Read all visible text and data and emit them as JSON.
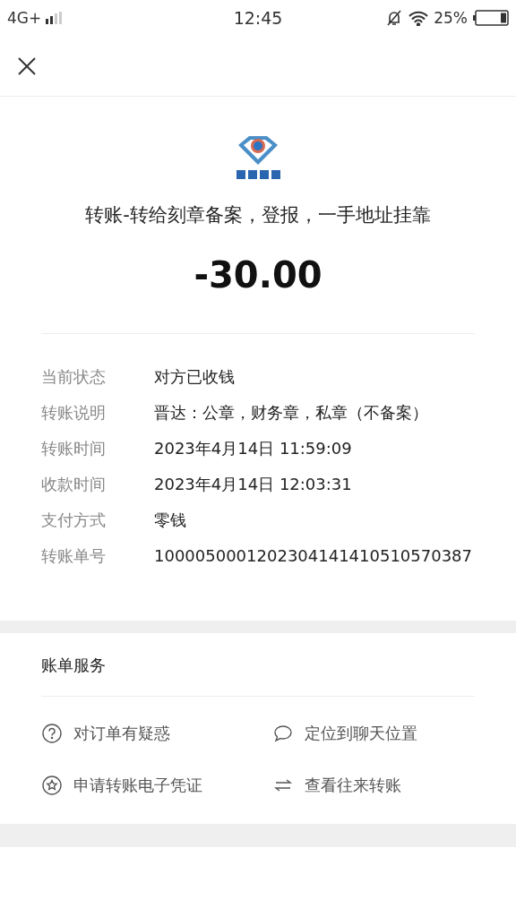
{
  "status_bar": {
    "network": "4G+",
    "time": "12:45",
    "battery": "25%"
  },
  "title": "转账-转给刻章备案，登报，一手地址挂靠",
  "amount": "-30.00",
  "details": [
    {
      "label": "当前状态",
      "value": "对方已收钱"
    },
    {
      "label": "转账说明",
      "value": "晋达：公章，财务章，私章（不备案）"
    },
    {
      "label": "转账时间",
      "value": "2023年4月14日 11:59:09"
    },
    {
      "label": "收款时间",
      "value": "2023年4月14日 12:03:31"
    },
    {
      "label": "支付方式",
      "value": "零钱"
    },
    {
      "label": "转账单号",
      "value": "1000050001202304141410510570387"
    }
  ],
  "services": {
    "title": "账单服务",
    "items": [
      {
        "kind": "question",
        "label": "对订单有疑惑"
      },
      {
        "kind": "chat",
        "label": "定位到聊天位置"
      },
      {
        "kind": "star",
        "label": "申请转账电子凭证"
      },
      {
        "kind": "exchange",
        "label": "查看往来转账"
      }
    ]
  }
}
